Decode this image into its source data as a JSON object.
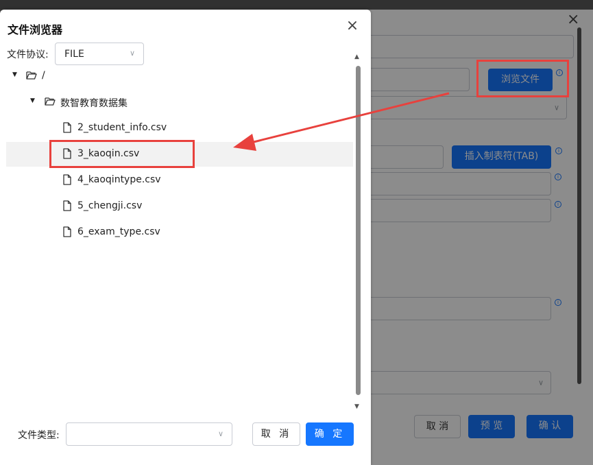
{
  "background_dialog": {
    "browse_button": "浏览文件",
    "insert_tab_button": "插入制表符(TAB)",
    "cancel_button": "取 消",
    "preview_button": "预 览",
    "confirm_button": "确 认",
    "close_icon": "close-icon",
    "info_icon": "info-icon"
  },
  "file_browser": {
    "title": "文件浏览器",
    "protocol_label": "文件协议:",
    "protocol_value": "FILE",
    "tree": {
      "root": "/",
      "folder": "数智教育数据集",
      "files": [
        "2_student_info.csv",
        "3_kaoqin.csv",
        "4_kaoqintype.csv",
        "5_chengji.csv",
        "6_exam_type.csv"
      ],
      "selected": "3_kaoqin.csv"
    },
    "filetype_label": "文件类型:",
    "filetype_value": "",
    "cancel_button": "取 消",
    "ok_button": "确 定"
  },
  "colors": {
    "primary": "#1677ff",
    "annotation_red": "#e8413d",
    "selected_row": "#f2f2f2"
  }
}
